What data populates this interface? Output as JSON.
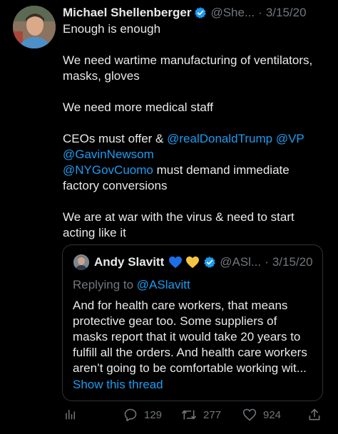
{
  "tweet": {
    "author": {
      "name": "Michael Shellenberger",
      "handle": "@She...",
      "separator": "·",
      "date": "3/15/20"
    },
    "lines": {
      "l1": "Enough is enough",
      "l2": "We need wartime manufacturing of ventilators,",
      "l3": "masks, gloves",
      "l4": "We need more medical staff",
      "l5_prefix": "CEOs must offer & ",
      "mention_trump": "@realDonaldTrump",
      "mention_vp": "@VP",
      "mention_newsom": "@GavinNewsom",
      "mention_cuomo": "@NYGovCuomo",
      "l7_suffix": " must demand immediate",
      "l8": "factory conversions",
      "l9": "We are at war with the virus & need to start",
      "l10": "acting like it"
    }
  },
  "quote": {
    "author": {
      "name": "Andy Slavitt",
      "handle": "@ASl...",
      "separator": "·",
      "date": "3/15/20"
    },
    "replying_prefix": "Replying to ",
    "replying_handle": "@ASlavitt",
    "lines": [
      "And for health care workers, that means",
      "protective gear too. Some suppliers of",
      "masks report that it would take 20 years to",
      "fulfill all the orders. And health care workers",
      "aren’t going to be comfortable working wit..."
    ],
    "show_thread": "Show this thread"
  },
  "actions": {
    "replies": "129",
    "retweets": "277",
    "likes": "924"
  },
  "colors": {
    "background": "#000000",
    "text": "#e7e9ea",
    "muted": "#71767b",
    "link": "#1d9bf0",
    "border": "#2f3336",
    "heart_blue": "#1d6fe8",
    "heart_yellow": "#f5c542"
  }
}
